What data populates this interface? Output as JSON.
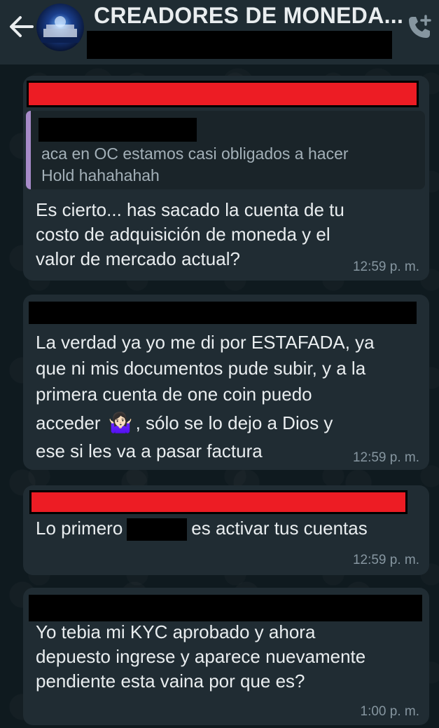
{
  "header": {
    "title": "CREADORES DE MONEDA...",
    "back_icon": "back-arrow-icon",
    "call_icon": "add-call-icon"
  },
  "messages": [
    {
      "quote_text_line1": "aca en OC estamos casi obligados a hacer",
      "quote_text_line2": "Hold hahahahah",
      "line1": "Es cierto... has sacado la cuenta de tu",
      "line2": "costo de adquisición de moneda y el",
      "line3": "valor de mercado actual?",
      "time": "12:59 p. m."
    },
    {
      "line1": "La verdad ya yo me di por ESTAFADA, ya",
      "line2": "que ni mis documentos  pude subir, y a la",
      "line3": "primera cuenta de one coin puedo",
      "line4a": "acceder",
      "emoji": "🤷🏻‍♀️",
      "line4b": ", sólo  se lo dejo a Dios  y",
      "line5": "ese si les va a pasar factura",
      "time": "12:59 p. m."
    },
    {
      "text_a": "Lo primero",
      "text_b": "es activar tus cuentas",
      "time": "12:59 p. m."
    },
    {
      "line1": "Yo tebia mi KYC aprobado y ahora",
      "line2": "depuesto ingrese y aparece nuevamente",
      "line3": "pendiente esta vaina por que es?",
      "time": "1:00 p. m."
    }
  ],
  "colors": {
    "header_bg": "#1f2c33",
    "bubble_bg": "#202c33",
    "text": "#e9edef",
    "meta": "#8696a0",
    "quote_bar": "#a78bc9",
    "redact_red": "#ed1c24"
  }
}
